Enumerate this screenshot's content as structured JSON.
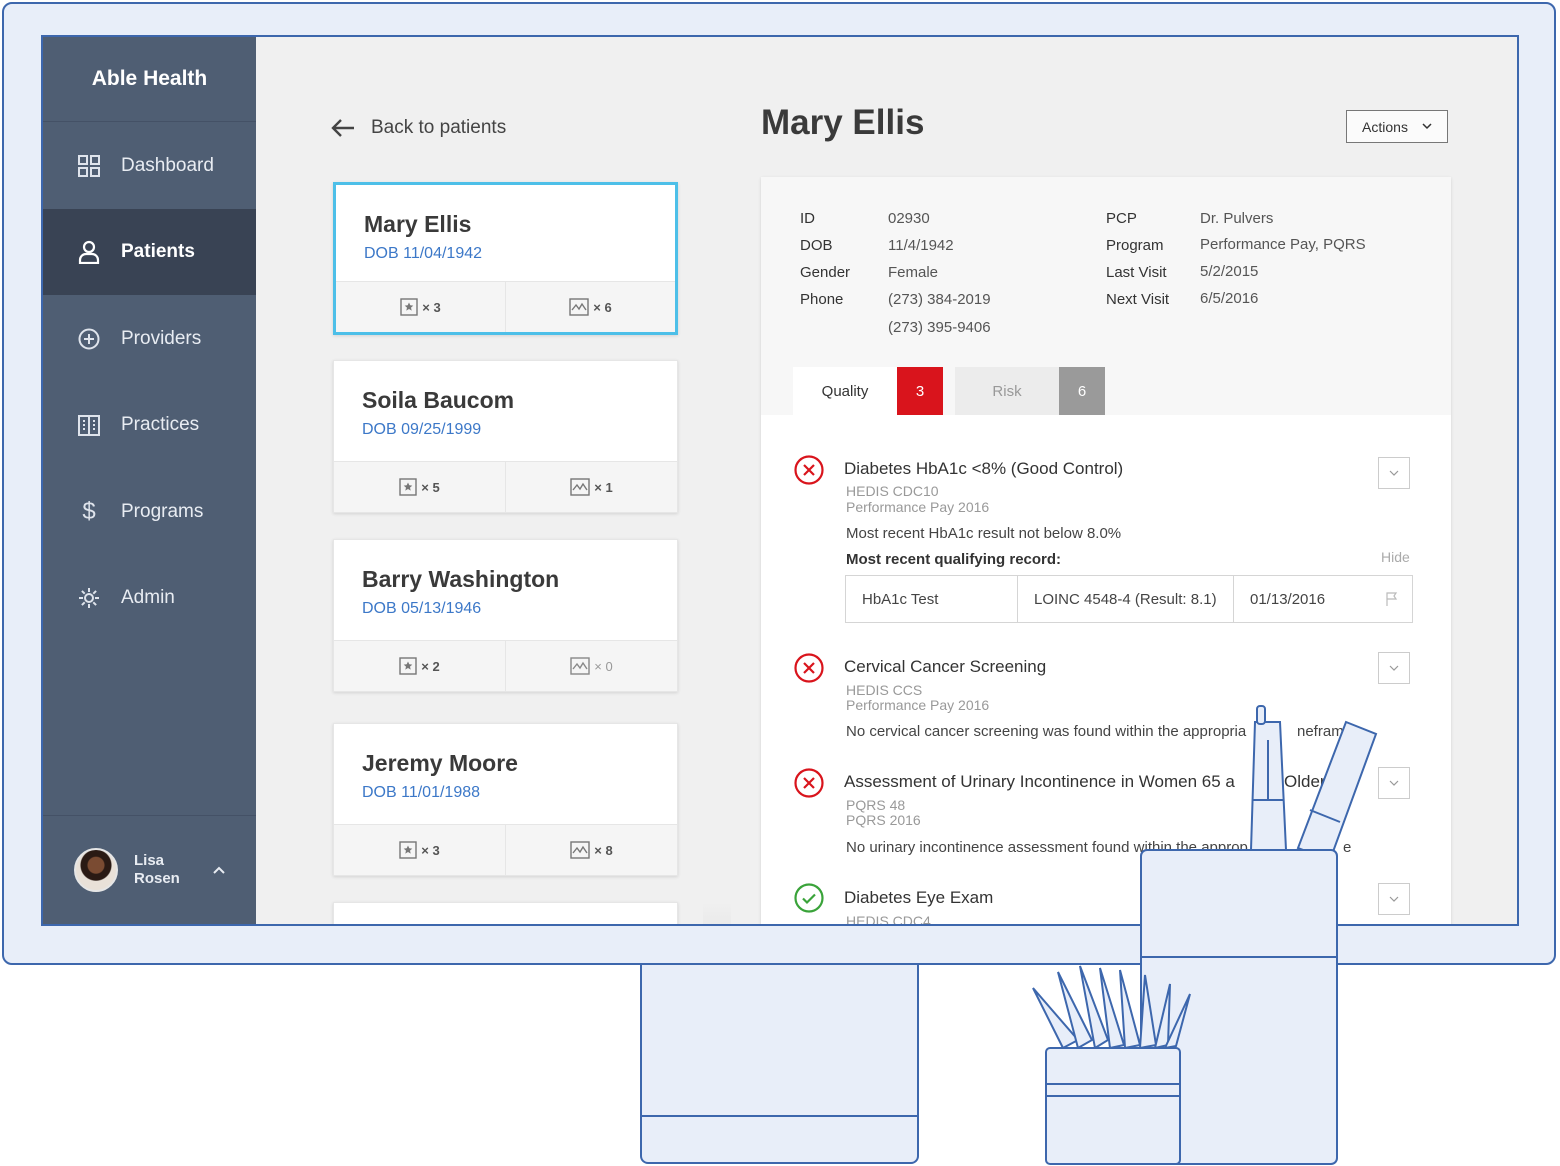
{
  "sidebar": {
    "brand": "Able Health",
    "items": [
      {
        "label": "Dashboard",
        "icon": "grid-icon"
      },
      {
        "label": "Patients",
        "icon": "user-icon",
        "active": true
      },
      {
        "label": "Providers",
        "icon": "plus-circle-icon"
      },
      {
        "label": "Practices",
        "icon": "building-icon"
      },
      {
        "label": "Programs",
        "icon": "dollar-icon"
      },
      {
        "label": "Admin",
        "icon": "gear-icon"
      }
    ],
    "user": {
      "first": "Lisa",
      "last": "Rosen"
    }
  },
  "back_label": "Back to patients",
  "patients": [
    {
      "name": "Mary Ellis",
      "dob": "DOB 11/04/1942",
      "quality": "× 3",
      "risk": "× 6"
    },
    {
      "name": "Soila Baucom",
      "dob": "DOB 09/25/1999",
      "quality": "× 5",
      "risk": "× 1"
    },
    {
      "name": "Barry Washington",
      "dob": "DOB 05/13/1946",
      "quality": "× 2",
      "risk": "× 0"
    },
    {
      "name": "Jeremy Moore",
      "dob": "DOB 11/01/1988",
      "quality": "× 3",
      "risk": "× 8"
    }
  ],
  "detail": {
    "title": "Mary Ellis",
    "actions_label": "Actions",
    "info_left": [
      {
        "label": "ID",
        "value": "02930"
      },
      {
        "label": "DOB",
        "value": "11/4/1942"
      },
      {
        "label": "Gender",
        "value": "Female"
      },
      {
        "label": "Phone",
        "value": "(273) 384-2019"
      }
    ],
    "phone_secondary": "(273) 395-9406",
    "info_right": [
      {
        "label": "PCP",
        "value": "Dr. Pulvers"
      },
      {
        "label": "Program",
        "value": "Performance Pay, PQRS"
      },
      {
        "label": "Last Visit",
        "value": "5/2/2015"
      },
      {
        "label": "Next Visit",
        "value": "6/5/2016"
      }
    ],
    "tabs": [
      {
        "label": "Quality",
        "count": "3",
        "color": "#d9141c"
      },
      {
        "label": "Risk",
        "count": "6",
        "color": "#9a9a9a"
      }
    ],
    "measures": [
      {
        "title": "Diabetes HbA1c <8% (Good Control)",
        "sub1": "HEDIS CDC10",
        "sub2": "Performance Pay 2016",
        "status": "fail",
        "text": "Most recent HbA1c result not below 8.0%"
      },
      {
        "title": "Cervical Cancer Screening",
        "sub1": "HEDIS CCS",
        "sub2": "Performance Pay 2016",
        "status": "fail",
        "text": "No cervical cancer screening was found within the appropria",
        "text_tail": "neframe"
      },
      {
        "title": "Assessment of Urinary Incontinence in Women 65 a",
        "title_tail": "Older",
        "sub1": "PQRS 48",
        "sub2": "PQRS 2016",
        "status": "fail",
        "text": "No urinary incontinence assessment found within the approp",
        "text_tail": "e"
      },
      {
        "title": "Diabetes Eye Exam",
        "sub1": "HEDIS CDC4",
        "status": "pass"
      }
    ],
    "record_heading": "Most recent qualifying record:",
    "hide_label": "Hide",
    "record": {
      "test": "HbA1c Test",
      "code": "LOINC 4548-4 (Result: 8.1)",
      "date": "01/13/2016"
    },
    "colors": {
      "fail": "#d9141c",
      "pass": "#3aa33a"
    }
  }
}
